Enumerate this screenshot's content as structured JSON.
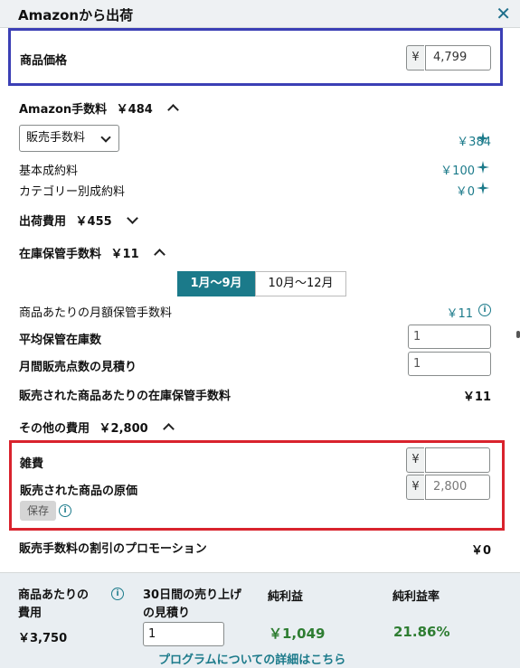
{
  "header": {
    "title": "Amazonから出荷",
    "close_icon": "close-icon"
  },
  "price": {
    "label": "商品価格",
    "currency": "¥",
    "value": "4,799"
  },
  "amazon_fee": {
    "title": "Amazon手数料",
    "total": "￥484",
    "dropdown": "販売手数料",
    "dropdown_value": "￥384",
    "rows": [
      {
        "label": "基本成約料",
        "value": "￥100"
      },
      {
        "label": "カテゴリー別成約料",
        "value": "￥0"
      }
    ]
  },
  "shipping": {
    "title": "出荷費用",
    "total": "￥455"
  },
  "storage": {
    "title": "在庫保管手数料",
    "total": "￥11",
    "tabs": [
      "1月〜9月",
      "10月〜12月"
    ],
    "monthly_label": "商品あたりの月額保管手数料",
    "monthly_value": "￥11",
    "avg_label": "平均保管在庫数",
    "avg_value": "1",
    "sales_label": "月間販売点数の見積り",
    "sales_value": "1",
    "per_item_label": "販売された商品あたりの在庫保管手数料",
    "per_item_value": "￥11"
  },
  "other": {
    "title": "その他の費用",
    "total": "￥2,800",
    "misc_label": "雑費",
    "misc_currency": "¥",
    "misc_value": "",
    "cost_label": "販売された商品の原価",
    "cost_currency": "¥",
    "cost_value": "2,800",
    "save_label": "保存"
  },
  "promo": {
    "label": "販売手数料の割引のプロモーション",
    "value": "￥0"
  },
  "footer": {
    "cost_label_1": "商品あたりの",
    "cost_label_2": "費用",
    "cost_value": "￥3,750",
    "sales_label_1": "30日間の売り上げ",
    "sales_label_2": "の見積り",
    "sales_value": "1",
    "profit_label": "純利益",
    "profit_value": "￥1,049",
    "margin_label": "純利益率",
    "margin_value": "21.86%",
    "link": "プログラムについての詳細はこちら"
  },
  "colors": {
    "blue_box": "#3b3fb5",
    "red_box": "#d9232d",
    "accent": "#1b7a8a",
    "green": "#2e7d32"
  }
}
